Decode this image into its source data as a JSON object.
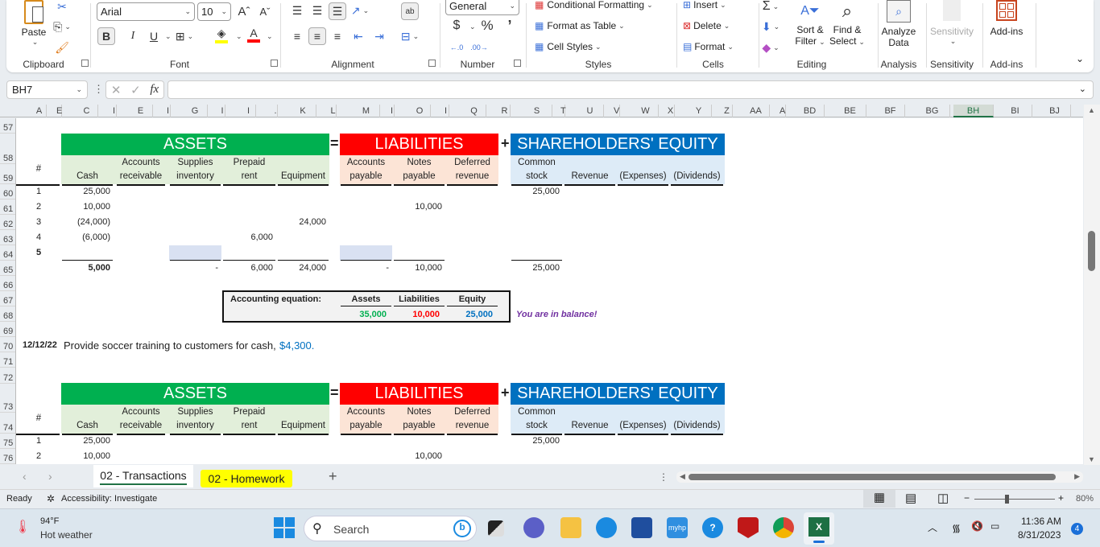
{
  "ribbon": {
    "clipboard": {
      "paste": "Paste",
      "label": "Clipboard"
    },
    "font": {
      "name": "Arial",
      "size": "10",
      "label": "Font",
      "bold": "B",
      "italic": "I",
      "underline": "U",
      "grow": "Aˆ",
      "shrink": "Aˇ",
      "fill_color": "#ffff00",
      "font_color": "#ff0000"
    },
    "alignment": {
      "label": "Alignment"
    },
    "number": {
      "format": "General",
      "currency": "$",
      "percent": "%",
      "comma": "’",
      "label": "Number"
    },
    "styles": {
      "conditional": "Conditional Formatting",
      "table": "Format as Table",
      "cell_styles": "Cell Styles",
      "label": "Styles"
    },
    "cells": {
      "insert": "Insert",
      "delete": "Delete",
      "format": "Format",
      "label": "Cells"
    },
    "editing": {
      "sort1": "Sort &",
      "sort2": "Filter",
      "find1": "Find &",
      "find2": "Select",
      "label": "Editing"
    },
    "analysis": {
      "btn1": "Analyze",
      "btn2": "Data",
      "label": "Analysis"
    },
    "sensitivity": {
      "btn": "Sensitivity",
      "label": "Sensitivity"
    },
    "addins": {
      "btn": "Add-ins",
      "label": "Add-ins"
    }
  },
  "formula_bar": {
    "name_box": "BH7",
    "fx": "fx",
    "formula": ""
  },
  "columns": [
    "A",
    "E",
    "C",
    "I",
    "E",
    "I",
    "G",
    "I",
    "I",
    ".",
    "K",
    "L",
    "M",
    "I",
    "O",
    "I",
    "Q",
    "R",
    "S",
    "T",
    "U",
    "V",
    "W",
    "X",
    "Y",
    "Z",
    "AA",
    "A",
    "BD",
    "BE",
    "BF",
    "BG",
    "BH",
    "BI",
    "BJ"
  ],
  "selected_column": "BH",
  "rows": [
    "57",
    "58",
    "59",
    "60",
    "61",
    "62",
    "63",
    "64",
    "65",
    "66",
    "67",
    "68",
    "69",
    "70",
    "71",
    "72",
    "73",
    "74",
    "75",
    "76"
  ],
  "table1": {
    "assets_title": "ASSETS",
    "liabilities_title": "LIABILITIES",
    "equity_title": "SHAREHOLDERS' EQUITY",
    "eq_sign": "=",
    "plus_sign": "+",
    "hash": "#",
    "headers": {
      "cash": [
        "",
        "Cash"
      ],
      "ar": [
        "Accounts",
        "receivable"
      ],
      "supplies": [
        "Supplies",
        "inventory"
      ],
      "prepaid": [
        "Prepaid",
        "rent"
      ],
      "equipment": [
        "",
        "Equipment"
      ],
      "ap": [
        "Accounts",
        "payable"
      ],
      "np": [
        "Notes",
        "payable"
      ],
      "dr": [
        "Deferred",
        "revenue"
      ],
      "cs": [
        "Common",
        "stock"
      ],
      "rev": [
        "",
        "Revenue"
      ],
      "exp": [
        "",
        "(Expenses)"
      ],
      "div": [
        "",
        "(Dividends)"
      ]
    },
    "rows": [
      {
        "n": "1",
        "cash": "25,000",
        "prepaid": "",
        "equipment": "",
        "np": "",
        "cs": "25,000"
      },
      {
        "n": "2",
        "cash": "10,000",
        "prepaid": "",
        "equipment": "",
        "np": "10,000",
        "cs": ""
      },
      {
        "n": "3",
        "cash": "(24,000)",
        "prepaid": "",
        "equipment": "24,000",
        "np": "",
        "cs": ""
      },
      {
        "n": "4",
        "cash": "(6,000)",
        "prepaid": "6,000",
        "equipment": "",
        "np": "",
        "cs": ""
      },
      {
        "n": "5",
        "cash": "",
        "prepaid": "",
        "equipment": "",
        "np": "",
        "cs": ""
      }
    ],
    "totals": {
      "cash": "5,000",
      "supplies": "-",
      "prepaid": "6,000",
      "equipment": "24,000",
      "ap": "-",
      "np": "10,000",
      "cs": "25,000"
    }
  },
  "equation": {
    "label": "Accounting equation:",
    "assets_label": "Assets",
    "liabilities_label": "Liabilities",
    "equity_label": "Equity",
    "assets": "35,000",
    "liabilities": "10,000",
    "equity": "25,000",
    "balance_msg": "You are in balance!",
    "colors": {
      "assets": "#00b050",
      "liabilities": "#ff0000",
      "equity": "#0070c0",
      "msg": "#7030a0"
    }
  },
  "transaction": {
    "date": "12/12/22",
    "text": "Provide soccer training to customers for cash,",
    "amount": "$4,300."
  },
  "table2": {
    "rows": [
      {
        "n": "1",
        "cash": "25,000",
        "np": "",
        "cs": "25,000"
      },
      {
        "n": "2",
        "cash": "10,000",
        "np": "10,000",
        "cs": ""
      }
    ]
  },
  "colors": {
    "assets": "#00b050",
    "assets_sub": "#e2efda",
    "liabilities": "#ff0000",
    "liabilities_sub": "#fce4d6",
    "equity": "#0070c0",
    "equity_sub": "#ddebf7",
    "highlight": "#d9e1f2"
  },
  "sheet_tabs": [
    {
      "label": "02 - Transactions",
      "active": true
    },
    {
      "label": "02 - Homework",
      "active": false,
      "color": "#ffff00"
    }
  ],
  "add_sheet": "+",
  "status": {
    "ready": "Ready",
    "accessibility": "Accessibility: Investigate",
    "zoom": "80%"
  },
  "taskbar": {
    "temp": "94°F",
    "weather": "Hot weather",
    "search": "Search",
    "time": "11:36 AM",
    "date": "8/31/2023",
    "notifications": "4"
  }
}
